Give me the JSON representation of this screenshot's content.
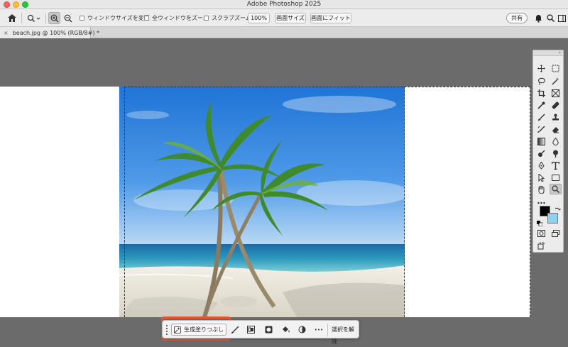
{
  "window": {
    "title": "Adobe Photoshop 2025"
  },
  "options_bar": {
    "resize_windows_label": "ウィンドウサイズを変更",
    "zoom_all_windows_label": "全ウィンドウをズーム",
    "scrubby_zoom_label": "スクラブズーム",
    "zoom_percent": "100%",
    "fit_screen_label": "画面サイズ",
    "fill_screen_label": "画面にフィット",
    "share_label": "共有"
  },
  "document": {
    "tab_label": "beach.jpg @ 100% (RGB/8#) *",
    "close_glyph": "×"
  },
  "tools_panel": {
    "grip_glyph": "»"
  },
  "taskbar": {
    "generative_fill_label": "生成塗りつぶし",
    "more_glyph": "•••",
    "deselect_label": "選択を解除"
  },
  "colors": {
    "highlight": "#e8552f",
    "background_swatch": "#8dd3f0",
    "foreground_swatch": "#000000"
  }
}
